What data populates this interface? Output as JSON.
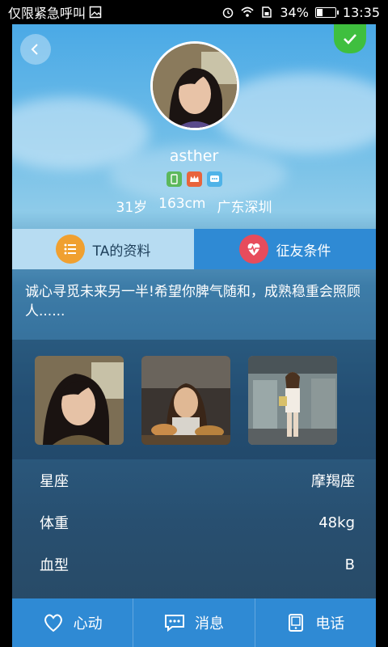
{
  "status_bar": {
    "left_text": "仅限紧急呼叫",
    "battery": "34%",
    "battery_level": 0.34,
    "time": "13:35"
  },
  "profile": {
    "username": "asther",
    "age": "31岁",
    "height": "163cm",
    "location": "广东深圳"
  },
  "tabs": [
    {
      "label": "TA的资料",
      "icon": "list-icon"
    },
    {
      "label": "征友条件",
      "icon": "heart-pulse-icon"
    }
  ],
  "intro": "诚心寻觅未来另一半!希望你脾气随和，成熟稳重会照顾人......",
  "details": [
    {
      "label": "星座",
      "value": "摩羯座"
    },
    {
      "label": "体重",
      "value": "48kg"
    },
    {
      "label": "血型",
      "value": "B"
    }
  ],
  "actions": [
    {
      "label": "心动",
      "icon": "heart-icon"
    },
    {
      "label": "消息",
      "icon": "chat-icon"
    },
    {
      "label": "电话",
      "icon": "phone-icon"
    }
  ],
  "colors": {
    "accent": "#2f8ad4",
    "tab_active": "#b7dcf2",
    "confirm": "#3fbf3f",
    "list_icon_bg": "#f0a030",
    "heart_icon_bg": "#e74c5c"
  }
}
